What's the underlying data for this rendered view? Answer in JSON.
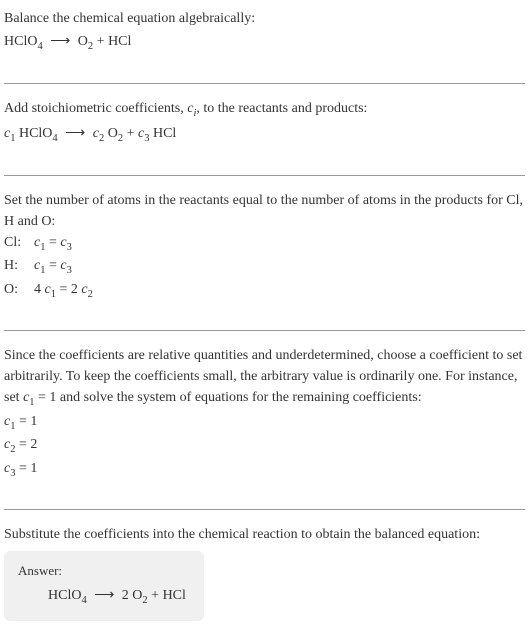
{
  "section1": {
    "title": "Balance the chemical equation algebraically:",
    "equation_lhs": "HClO",
    "equation_lhs_sub": "4",
    "arrow": "⟶",
    "equation_rhs1": "O",
    "equation_rhs1_sub": "2",
    "plus": " + ",
    "equation_rhs2": "HCl"
  },
  "section2": {
    "title_part1": "Add stoichiometric coefficients, ",
    "title_coef": "c",
    "title_coef_sub": "i",
    "title_part2": ", to the reactants and products:",
    "c1": "c",
    "c1_sub": "1",
    "lhs": " HClO",
    "lhs_sub": "4",
    "arrow": "⟶",
    "c2": "c",
    "c2_sub": "2",
    "mid": " O",
    "mid_sub": "2",
    "plus": " + ",
    "c3": "c",
    "c3_sub": "3",
    "rhs": " HCl"
  },
  "section3": {
    "title": "Set the number of atoms in the reactants equal to the number of atoms in the products for Cl, H and O:",
    "cl_label": "Cl:",
    "cl_eq_c1": "c",
    "cl_eq_c1_sub": "1",
    "cl_eq_eq": " = ",
    "cl_eq_c3": "c",
    "cl_eq_c3_sub": "3",
    "h_label": "H:",
    "h_eq_c1": "c",
    "h_eq_c1_sub": "1",
    "h_eq_eq": " = ",
    "h_eq_c3": "c",
    "h_eq_c3_sub": "3",
    "o_label": "O:",
    "o_eq_4": "4 ",
    "o_eq_c1": "c",
    "o_eq_c1_sub": "1",
    "o_eq_eq": " = 2 ",
    "o_eq_c2": "c",
    "o_eq_c2_sub": "2"
  },
  "section4": {
    "title_part1": "Since the coefficients are relative quantities and underdetermined, choose a coefficient to set arbitrarily. To keep the coefficients small, the arbitrary value is ordinarily one. For instance, set ",
    "title_c1": "c",
    "title_c1_sub": "1",
    "title_part2": " = 1 and solve the system of equations for the remaining coefficients:",
    "c1": "c",
    "c1_sub": "1",
    "c1_val": " = 1",
    "c2": "c",
    "c2_sub": "2",
    "c2_val": " = 2",
    "c3": "c",
    "c3_sub": "3",
    "c3_val": " = 1"
  },
  "section5": {
    "title": "Substitute the coefficients into the chemical reaction to obtain the balanced equation:",
    "answer_label": "Answer:",
    "lhs": "HClO",
    "lhs_sub": "4",
    "arrow": "⟶",
    "coef": " 2 ",
    "mid": "O",
    "mid_sub": "2",
    "plus": " + ",
    "rhs": "HCl"
  }
}
